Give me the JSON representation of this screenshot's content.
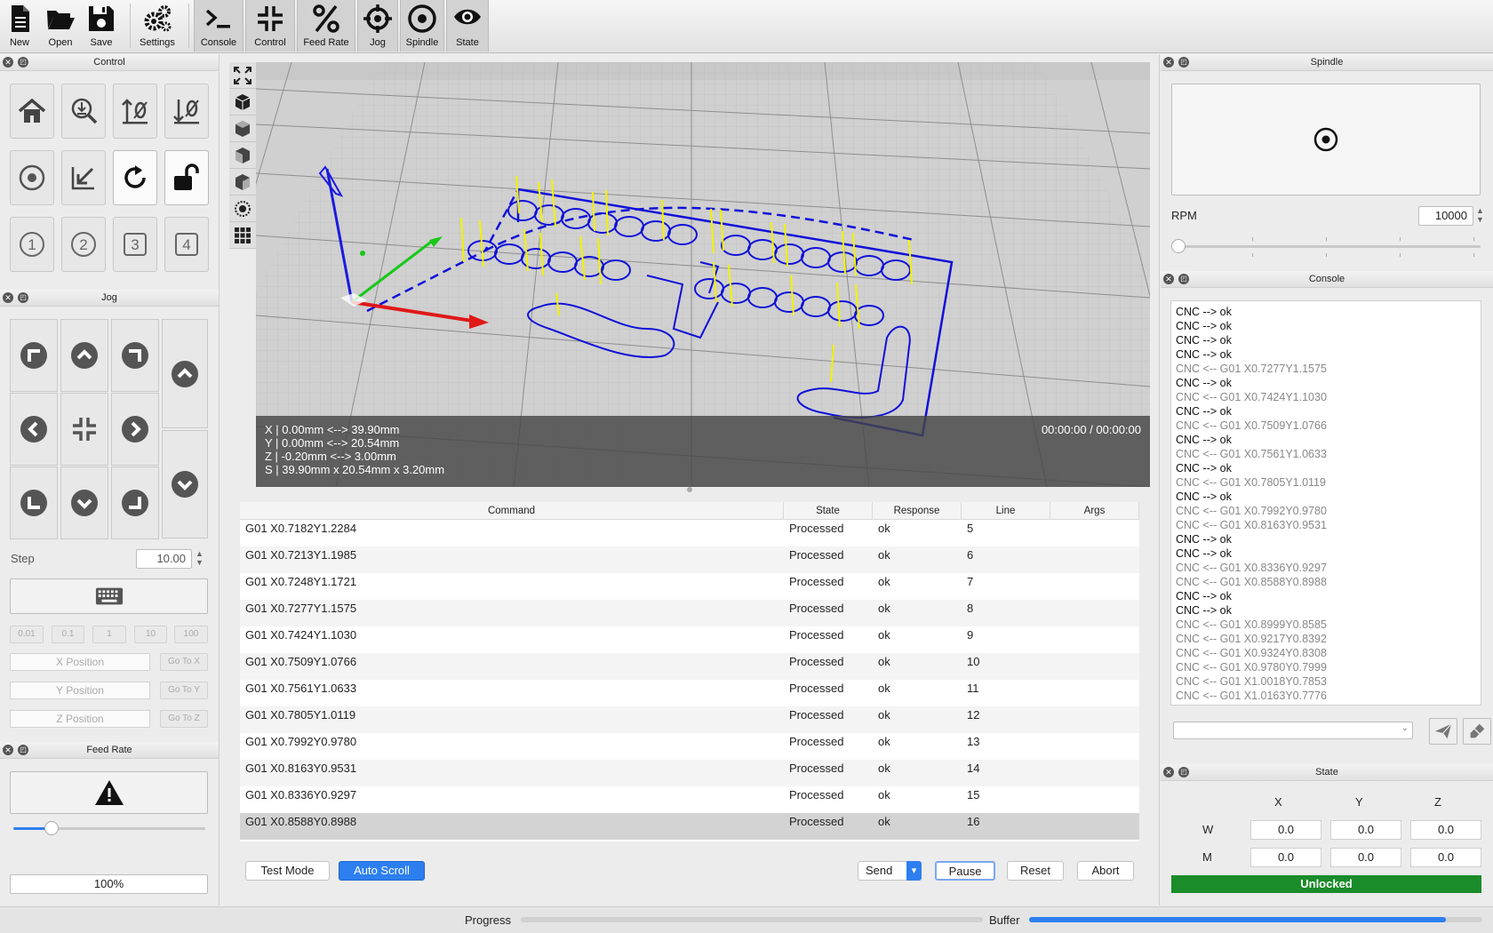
{
  "toolbar": {
    "new": "New",
    "open": "Open",
    "save": "Save",
    "settings": "Settings",
    "console": "Console",
    "control": "Control",
    "feed_rate": "Feed Rate",
    "jog": "Jog",
    "spindle": "Spindle",
    "state": "State"
  },
  "docks": {
    "control": "Control",
    "jog": "Jog",
    "feed_rate": "Feed Rate",
    "spindle": "Spindle",
    "console": "Console",
    "state": "State"
  },
  "control_panel": {
    "macros": [
      "1",
      "2",
      "3",
      "4"
    ]
  },
  "jog_panel": {
    "step_label": "Step",
    "step_value": "10.00",
    "step_presets": [
      "0.01",
      "0.1",
      "1",
      "10",
      "100"
    ],
    "x_placeholder": "X Position",
    "y_placeholder": "Y Position",
    "z_placeholder": "Z Position",
    "goto_x": "Go To X",
    "goto_y": "Go To Y",
    "goto_z": "Go To Z"
  },
  "feed_panel": {
    "value": "100%",
    "slider_fraction": 0.2
  },
  "viewport": {
    "x_range": "X | 0.00mm <--> 39.90mm",
    "y_range": "Y | 0.00mm <--> 20.54mm",
    "z_range": "Z | -0.20mm <--> 3.00mm",
    "size": "S | 39.90mm x 20.54mm x 3.20mm",
    "time": "00:00:00 / 00:00:00"
  },
  "table": {
    "headers": [
      "Command",
      "State",
      "Response",
      "Line",
      "Args"
    ],
    "rows": [
      {
        "command": "G01 X0.7182Y1.2284",
        "state": "Processed",
        "response": "ok",
        "line": "5"
      },
      {
        "command": "G01 X0.7213Y1.1985",
        "state": "Processed",
        "response": "ok",
        "line": "6"
      },
      {
        "command": "G01 X0.7248Y1.1721",
        "state": "Processed",
        "response": "ok",
        "line": "7"
      },
      {
        "command": "G01 X0.7277Y1.1575",
        "state": "Processed",
        "response": "ok",
        "line": "8"
      },
      {
        "command": "G01 X0.7424Y1.1030",
        "state": "Processed",
        "response": "ok",
        "line": "9"
      },
      {
        "command": "G01 X0.7509Y1.0766",
        "state": "Processed",
        "response": "ok",
        "line": "10"
      },
      {
        "command": "G01 X0.7561Y1.0633",
        "state": "Processed",
        "response": "ok",
        "line": "11"
      },
      {
        "command": "G01 X0.7805Y1.0119",
        "state": "Processed",
        "response": "ok",
        "line": "12"
      },
      {
        "command": "G01 X0.7992Y0.9780",
        "state": "Processed",
        "response": "ok",
        "line": "13"
      },
      {
        "command": "G01 X0.8163Y0.9531",
        "state": "Processed",
        "response": "ok",
        "line": "14"
      },
      {
        "command": "G01 X0.8336Y0.9297",
        "state": "Processed",
        "response": "ok",
        "line": "15"
      },
      {
        "command": "G01 X0.8588Y0.8988",
        "state": "Processed",
        "response": "ok",
        "line": "16"
      }
    ]
  },
  "program_buttons": {
    "test_mode": "Test Mode",
    "auto_scroll": "Auto Scroll",
    "send": "Send",
    "pause": "Pause",
    "reset": "Reset",
    "abort": "Abort"
  },
  "spindle_panel": {
    "rpm_label": "RPM",
    "rpm_value": "10000"
  },
  "console_panel": {
    "lines": [
      {
        "text": "CNC --> ok",
        "type": "recv"
      },
      {
        "text": "CNC --> ok",
        "type": "recv"
      },
      {
        "text": "CNC --> ok",
        "type": "recv"
      },
      {
        "text": "CNC --> ok",
        "type": "recv"
      },
      {
        "text": "CNC <-- G01 X0.7277Y1.1575",
        "type": "sent"
      },
      {
        "text": "CNC --> ok",
        "type": "recv"
      },
      {
        "text": "CNC <-- G01 X0.7424Y1.1030",
        "type": "sent"
      },
      {
        "text": "CNC --> ok",
        "type": "recv"
      },
      {
        "text": "CNC <-- G01 X0.7509Y1.0766",
        "type": "sent"
      },
      {
        "text": "CNC --> ok",
        "type": "recv"
      },
      {
        "text": "CNC <-- G01 X0.7561Y1.0633",
        "type": "sent"
      },
      {
        "text": "CNC --> ok",
        "type": "recv"
      },
      {
        "text": "CNC <-- G01 X0.7805Y1.0119",
        "type": "sent"
      },
      {
        "text": "CNC --> ok",
        "type": "recv"
      },
      {
        "text": "CNC <-- G01 X0.7992Y0.9780",
        "type": "sent"
      },
      {
        "text": "CNC <-- G01 X0.8163Y0.9531",
        "type": "sent"
      },
      {
        "text": "CNC --> ok",
        "type": "recv"
      },
      {
        "text": "CNC --> ok",
        "type": "recv"
      },
      {
        "text": "CNC <-- G01 X0.8336Y0.9297",
        "type": "sent"
      },
      {
        "text": "CNC <-- G01 X0.8588Y0.8988",
        "type": "sent"
      },
      {
        "text": "CNC --> ok",
        "type": "recv"
      },
      {
        "text": "CNC --> ok",
        "type": "recv"
      },
      {
        "text": "CNC <-- G01 X0.8999Y0.8585",
        "type": "sent"
      },
      {
        "text": "CNC <-- G01 X0.9217Y0.8392",
        "type": "sent"
      },
      {
        "text": "CNC <-- G01 X0.9324Y0.8308",
        "type": "sent"
      },
      {
        "text": "CNC <-- G01 X0.9780Y0.7999",
        "type": "sent"
      },
      {
        "text": "CNC <-- G01 X1.0018Y0.7853",
        "type": "sent"
      },
      {
        "text": "CNC <-- G01 X1.0163Y0.7776",
        "type": "sent"
      }
    ]
  },
  "state_panel": {
    "axes": [
      "X",
      "Y",
      "Z"
    ],
    "w_label": "W",
    "m_label": "M",
    "w_values": [
      "0.0",
      "0.0",
      "0.0"
    ],
    "m_values": [
      "0.0",
      "0.0",
      "0.0"
    ],
    "status": "Unlocked",
    "status_color": "#1a8c2a"
  },
  "statusbar": {
    "progress_label": "Progress",
    "progress_fraction": 0.0,
    "buffer_label": "Buffer",
    "buffer_fraction": 0.92
  },
  "colors": {
    "accent": "#2d7ff0",
    "toolpath": "#1010d8"
  }
}
